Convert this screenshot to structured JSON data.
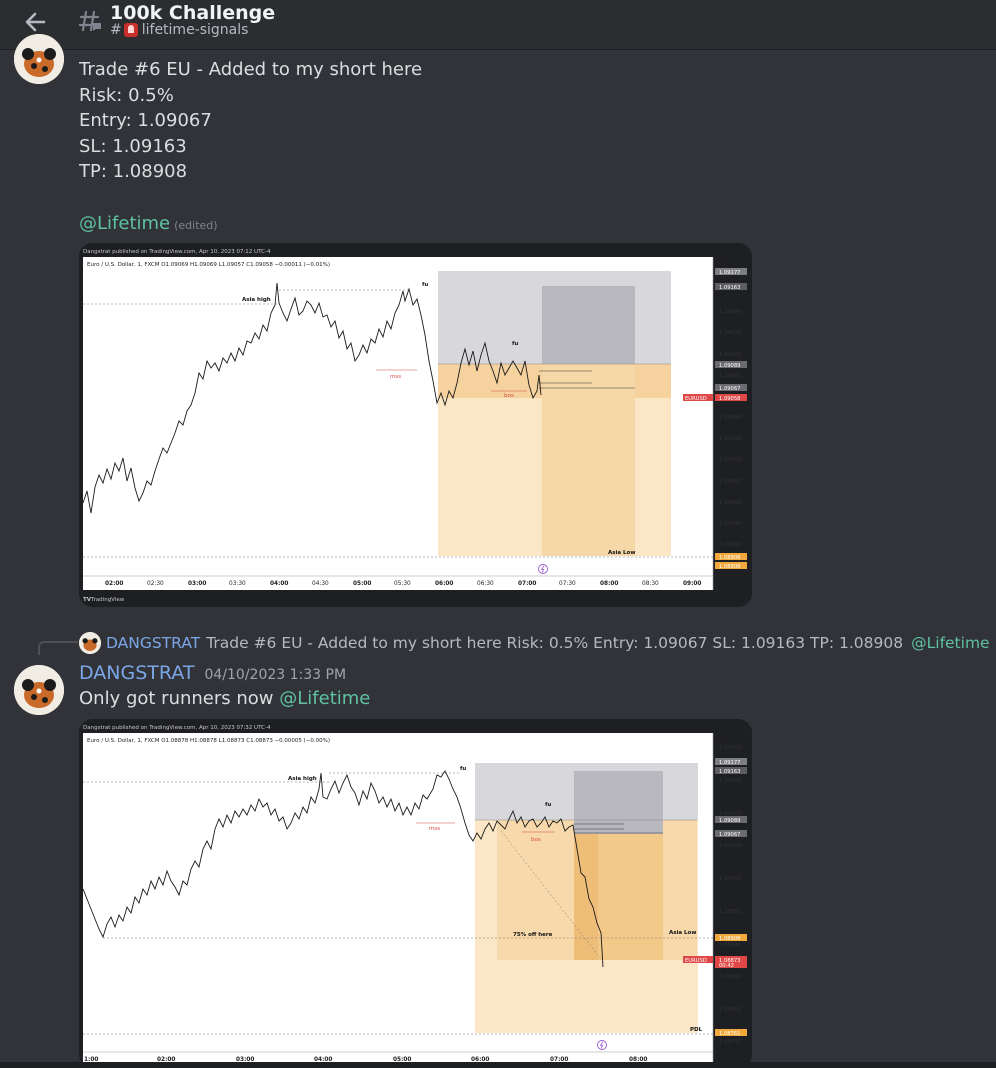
{
  "header": {
    "title": "100k Challenge",
    "channel": "lifetime-signals",
    "hash": "#"
  },
  "message1": {
    "lines": [
      "Trade #6 EU - Added to my short here",
      "Risk: 0.5%",
      "Entry: 1.09067",
      "SL: 1.09163",
      "TP: 1.08908"
    ],
    "mention": "@Lifetime",
    "edited": "(edited)"
  },
  "chart1": {
    "published": "Dangstrat published on TradingView.com, Apr 10, 2023 07:12 UTC-4",
    "ohlc": "Euro / U.S. Dollar, 1, FXCM  O1.09069  H1.09069  L1.09057  C1.09058  −0.00011 (−0.01%)",
    "currency": "USD",
    "footer": "TradingView",
    "xticks": [
      "02:00",
      "02:30",
      "03:00",
      "03:30",
      "04:00",
      "04:30",
      "05:00",
      "05:30",
      "06:00",
      "06:30",
      "07:00",
      "07:30",
      "08:00",
      "08:30",
      "09:00"
    ],
    "yticks": [
      "1.09140",
      "1.09120",
      "1.09100",
      "1.09080",
      "1.09040",
      "1.09020",
      "1.09000",
      "1.08980",
      "1.08960",
      "1.08940",
      "1.08920"
    ],
    "price_tags": [
      "1.09177",
      "1.09163",
      "1.09089",
      "1.09067",
      "1.09058",
      "1.08908",
      "1.08908"
    ],
    "symbol_tag": "EURUSD",
    "labels": {
      "asia_high": "Asia high",
      "fu1": "fu",
      "fu2": "fu",
      "mss": "mss",
      "bos": "bos",
      "asia_low": "Asia Low"
    }
  },
  "reply": {
    "author": "DANGSTRAT",
    "text": "Trade #6 EU - Added to my short here Risk: 0.5% Entry: 1.09067 SL: 1.09163 TP: 1.08908",
    "mention": "@Lifetime"
  },
  "message2": {
    "author": "DANGSTRAT",
    "timestamp": "04/10/2023 1:33 PM",
    "text": "Only got runners now",
    "mention": "@Lifetime"
  },
  "chart2": {
    "published": "Dangstrat published on TradingView.com, Apr 10, 2023 07:32 UTC-4",
    "ohlc": "Euro / U.S. Dollar, 1, FXCM  O1.08878  H1.08878  L1.08873  C1.08873  −0.00005 (−0.00%)",
    "currency": "USD",
    "xticks": [
      "1:00",
      "02:00",
      "03:00",
      "04:00",
      "05:00",
      "06:00",
      "07:00",
      "08:00"
    ],
    "yticks": [
      "1.09200",
      "1.09150",
      "1.09100",
      "1.09050",
      "1.09000",
      "1.08950",
      "1.08850",
      "1.08800",
      "1.08750"
    ],
    "price_tags": [
      "1.09177",
      "1.09163",
      "1.09089",
      "1.09067",
      "1.08908",
      "1.08900",
      "1.08873",
      "00:42",
      "1.08761"
    ],
    "symbol_tag": "EURUSD",
    "labels": {
      "asia_high": "Asia high",
      "fu1": "fu",
      "fu2": "fu",
      "mss": "mss",
      "bos": "bos",
      "off": "75% off here",
      "asia_low": "Asia Low",
      "pdl": "PDL"
    }
  }
}
